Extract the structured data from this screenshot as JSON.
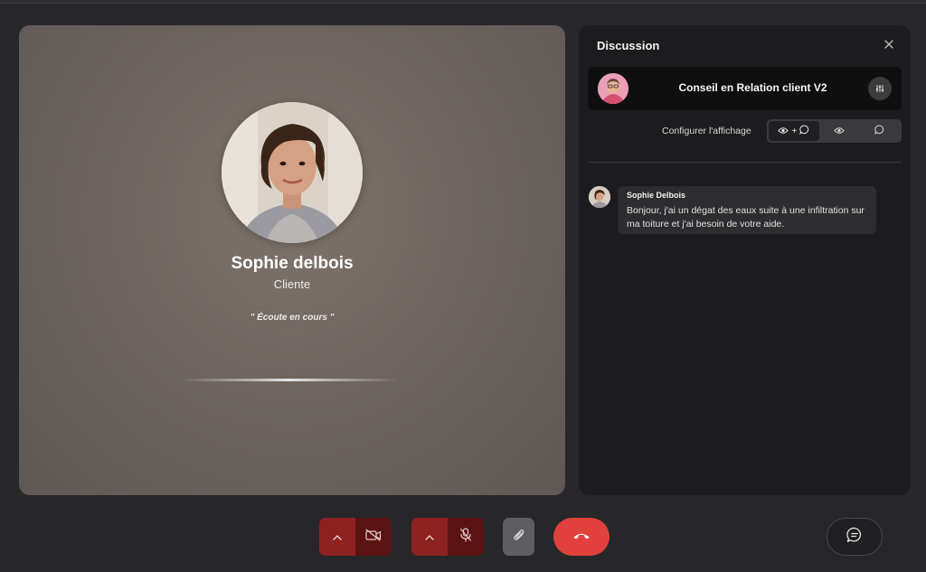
{
  "caller": {
    "name": "Sophie delbois",
    "role": "Cliente",
    "status": "\" Écoute en cours \""
  },
  "panel": {
    "title": "Discussion",
    "agent_name": "Conseil en Relation client V2",
    "config_label": "Configurer l'affichage",
    "view_options": [
      "eye+chat",
      "eye",
      "chat"
    ],
    "view_selected": "eye+chat",
    "seg_plus": "+"
  },
  "messages": [
    {
      "author": "Sophie Delbois",
      "text": "Bonjour, j'ai un dégat des eaux suite à une infiltration sur ma toiture et j'ai besoin de votre aide."
    }
  ],
  "controls": {
    "video_muted": true,
    "mic_muted": true
  },
  "colors": {
    "accent_red": "#e0413d",
    "control_red": "#8e2222",
    "control_dark_red": "#5a1313",
    "panel_bg": "#1c1c1e"
  },
  "icons": [
    "close-icon",
    "equalizer-icon",
    "eye-icon",
    "chat-bubble-icon",
    "chevron-up-icon",
    "video-off-icon",
    "mic-off-icon",
    "paperclip-icon",
    "phone-hangup-icon",
    "chat-dots-icon"
  ]
}
